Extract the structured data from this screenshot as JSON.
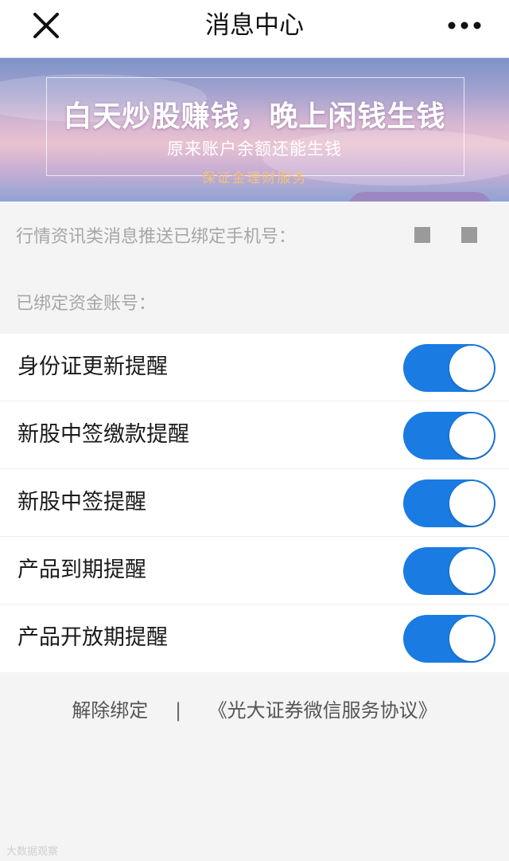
{
  "header": {
    "title": "消息中心",
    "close_icon": "close-icon",
    "more_icon": "more-icon"
  },
  "banner": {
    "headline": "白天炒股赚钱，晚上闲钱生钱",
    "subtitle": "原来账户余额还能生钱",
    "service": "保证金理财服务"
  },
  "bindings": {
    "phone_label": "行情资讯类消息推送已绑定手机号：",
    "account_label": "已绑定资金账号："
  },
  "settings": [
    {
      "label": "身份证更新提醒",
      "enabled": true
    },
    {
      "label": "新股中签缴款提醒",
      "enabled": true
    },
    {
      "label": "新股中签提醒",
      "enabled": true
    },
    {
      "label": "产品到期提醒",
      "enabled": true
    },
    {
      "label": "产品开放期提醒",
      "enabled": true
    }
  ],
  "footer": {
    "unbind": "解除绑定",
    "separator": "|",
    "agreement": "《光大证券微信服务协议》"
  },
  "watermark": "大数据观察",
  "colors": {
    "toggle_on": "#1a7ce2",
    "page_bg": "#f4f4f4"
  }
}
